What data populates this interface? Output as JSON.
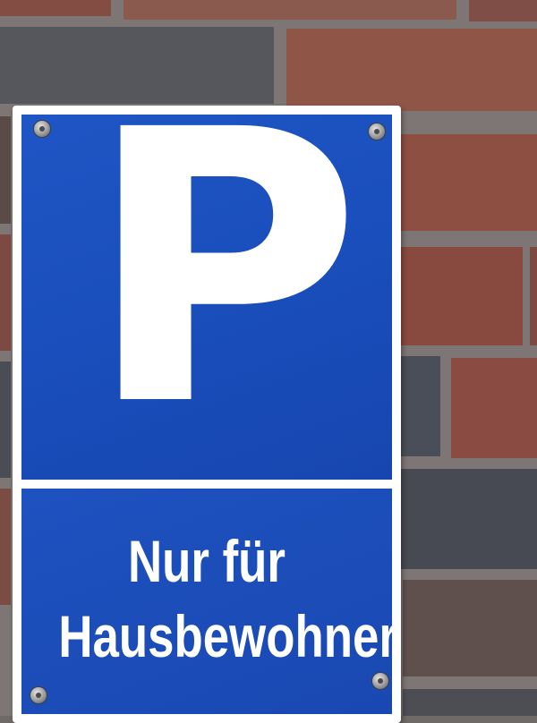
{
  "sign": {
    "symbol": "P",
    "caption_line1": "Nur für",
    "caption_line2": "Hausbewohner",
    "colors": {
      "sign_blue": "#1a4fbd",
      "sign_white": "#ffffff",
      "brick_red": "#8a4d3e",
      "brick_grey": "#4c5058"
    }
  }
}
